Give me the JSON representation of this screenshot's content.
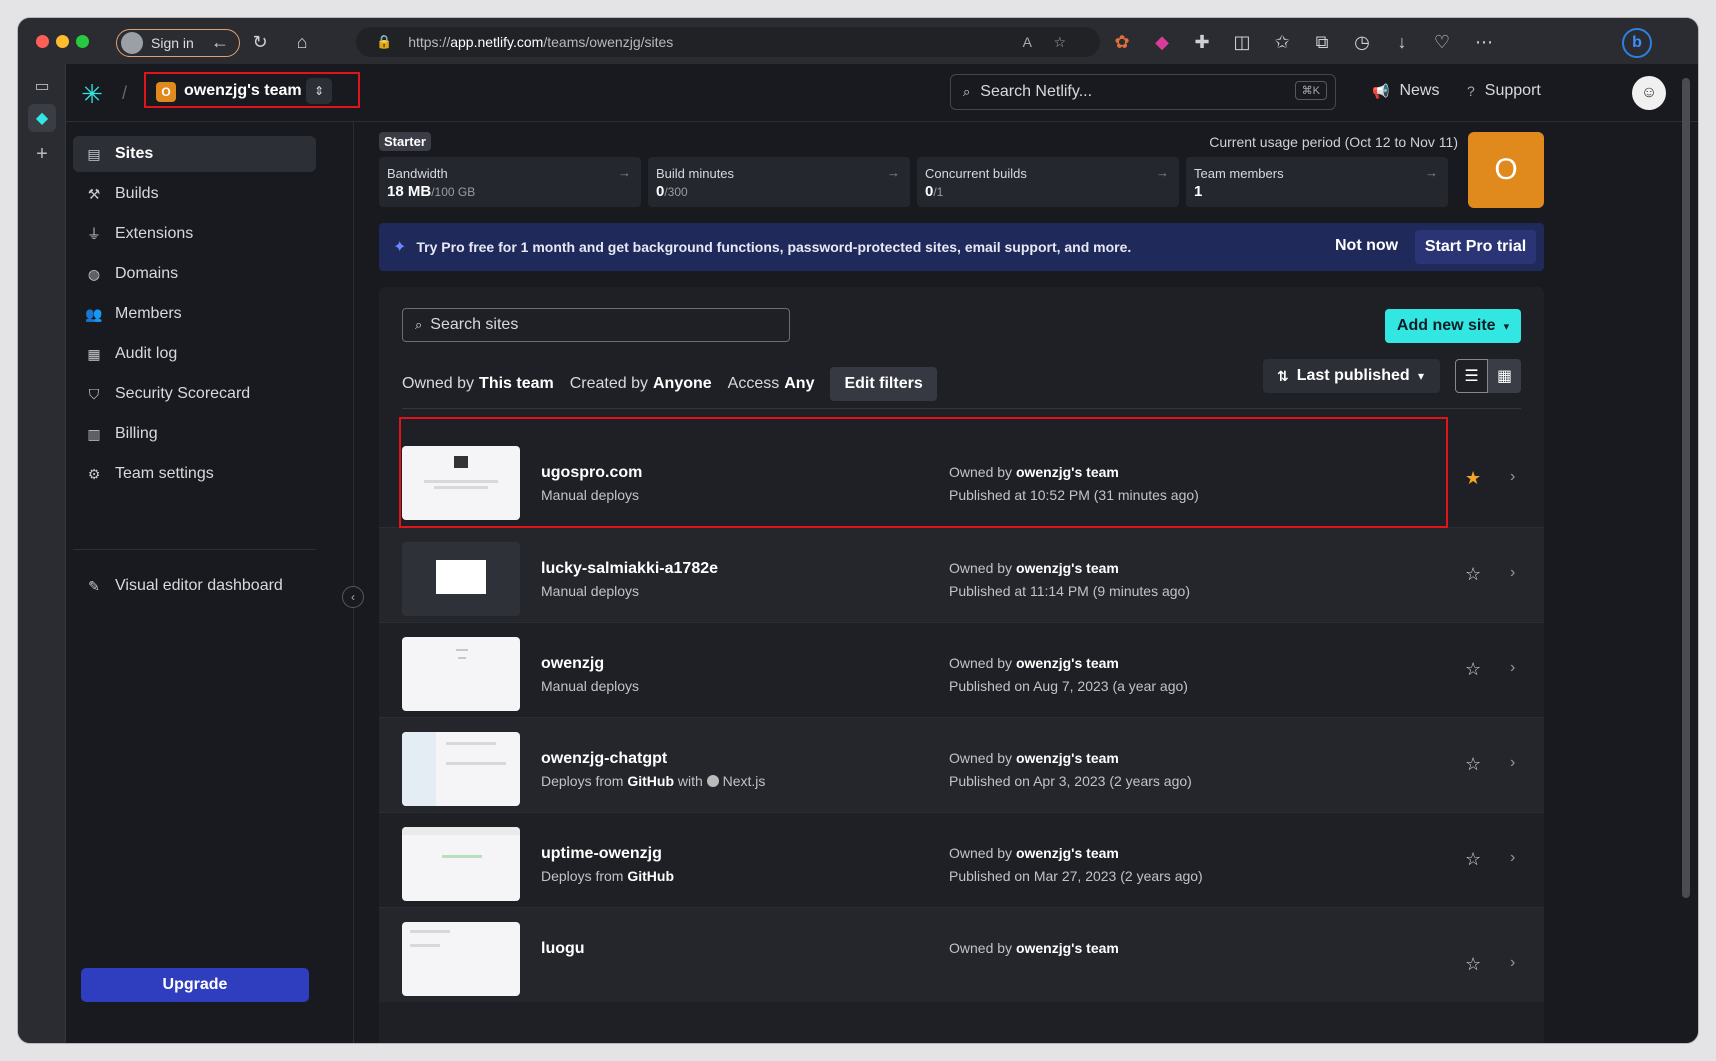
{
  "browser": {
    "signin_label": "Sign in",
    "url_scheme": "https://",
    "url_host": "app.netlify.com",
    "url_path": "/teams/owenzjg/sites"
  },
  "topbar": {
    "team_initial": "O",
    "team_name": "owenzjg's team",
    "search_placeholder": "Search Netlify...",
    "search_shortcut": "⌘K",
    "news_label": "News",
    "support_label": "Support"
  },
  "sidebar": {
    "items": [
      {
        "label": "Sites",
        "icon": "stack-icon"
      },
      {
        "label": "Builds",
        "icon": "hammer-icon"
      },
      {
        "label": "Extensions",
        "icon": "plug-icon"
      },
      {
        "label": "Domains",
        "icon": "globe-icon"
      },
      {
        "label": "Members",
        "icon": "members-icon"
      },
      {
        "label": "Audit log",
        "icon": "log-icon"
      },
      {
        "label": "Security Scorecard",
        "icon": "shield-icon"
      },
      {
        "label": "Billing",
        "icon": "billing-icon"
      },
      {
        "label": "Team settings",
        "icon": "gear-icon"
      }
    ],
    "visual_editor_label": "Visual editor dashboard",
    "upgrade_label": "Upgrade"
  },
  "usage": {
    "plan": "Starter",
    "period": "Current usage period (Oct 12 to Nov 11)",
    "avatar_initial": "O",
    "stats": [
      {
        "label": "Bandwidth",
        "value": "18 MB",
        "limit": "/100 GB"
      },
      {
        "label": "Build minutes",
        "value": "0",
        "limit": "/300"
      },
      {
        "label": "Concurrent builds",
        "value": "0",
        "limit": "/1"
      },
      {
        "label": "Team members",
        "value": "1",
        "limit": ""
      }
    ]
  },
  "promo": {
    "text": "Try Pro free for 1 month and get background functions, password-protected sites, email support, and more.",
    "not_now": "Not now",
    "start_trial": "Start Pro trial"
  },
  "sites": {
    "search_placeholder": "Search sites",
    "add_new_label": "Add new site",
    "filters": {
      "owned_by_label": "Owned by",
      "owned_by_value": "This team",
      "created_by_label": "Created by",
      "created_by_value": "Anyone",
      "access_label": "Access",
      "access_value": "Any",
      "edit_label": "Edit filters"
    },
    "sort_label": "Last published",
    "owner_prefix": "Owned by",
    "owner_name": "owenzjg's team",
    "list": [
      {
        "name": "ugospro.com",
        "deploy": "Manual deploys",
        "published": "Published at 10:52 PM (31 minutes ago)",
        "starred": true
      },
      {
        "name": "lucky-salmiakki-a1782e",
        "deploy": "Manual deploys",
        "published": "Published at 11:14 PM (9 minutes ago)",
        "starred": false
      },
      {
        "name": "owenzjg",
        "deploy": "Manual deploys",
        "published": "Published on Aug 7, 2023 (a year ago)",
        "starred": false
      },
      {
        "name": "owenzjg-chatgpt",
        "deploy_prefix": "Deploys from",
        "deploy_source": "GitHub",
        "deploy_with": "with",
        "deploy_fw": "Next.js",
        "published": "Published on Apr 3, 2023 (2 years ago)",
        "starred": false
      },
      {
        "name": "uptime-owenzjg",
        "deploy_prefix": "Deploys from",
        "deploy_source": "GitHub",
        "published": "Published on Mar 27, 2023 (2 years ago)",
        "starred": false
      },
      {
        "name": "luogu",
        "published": "",
        "starred": false
      }
    ]
  }
}
